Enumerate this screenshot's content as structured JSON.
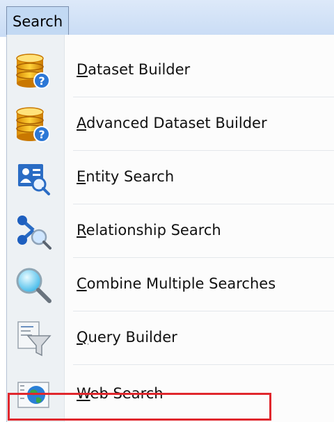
{
  "menubar": {
    "tab_label": "Search"
  },
  "items": [
    {
      "mnemonic": "D",
      "rest": "ataset Builder",
      "icon": "database-help-icon"
    },
    {
      "mnemonic": "A",
      "rest": "dvanced Dataset Builder",
      "icon": "database-help-icon"
    },
    {
      "mnemonic": "E",
      "rest": "ntity Search",
      "icon": "entity-search-icon"
    },
    {
      "mnemonic": "R",
      "rest": "elationship Search",
      "icon": "relationship-search-icon"
    },
    {
      "mnemonic": "C",
      "rest": "ombine Multiple Searches",
      "icon": "magnifier-icon"
    },
    {
      "mnemonic": "Q",
      "rest": "uery Builder",
      "icon": "funnel-document-icon"
    },
    {
      "mnemonic": "W",
      "rest": "eb Search",
      "icon": "globe-web-icon"
    }
  ],
  "annotation_color": "#e0272d"
}
